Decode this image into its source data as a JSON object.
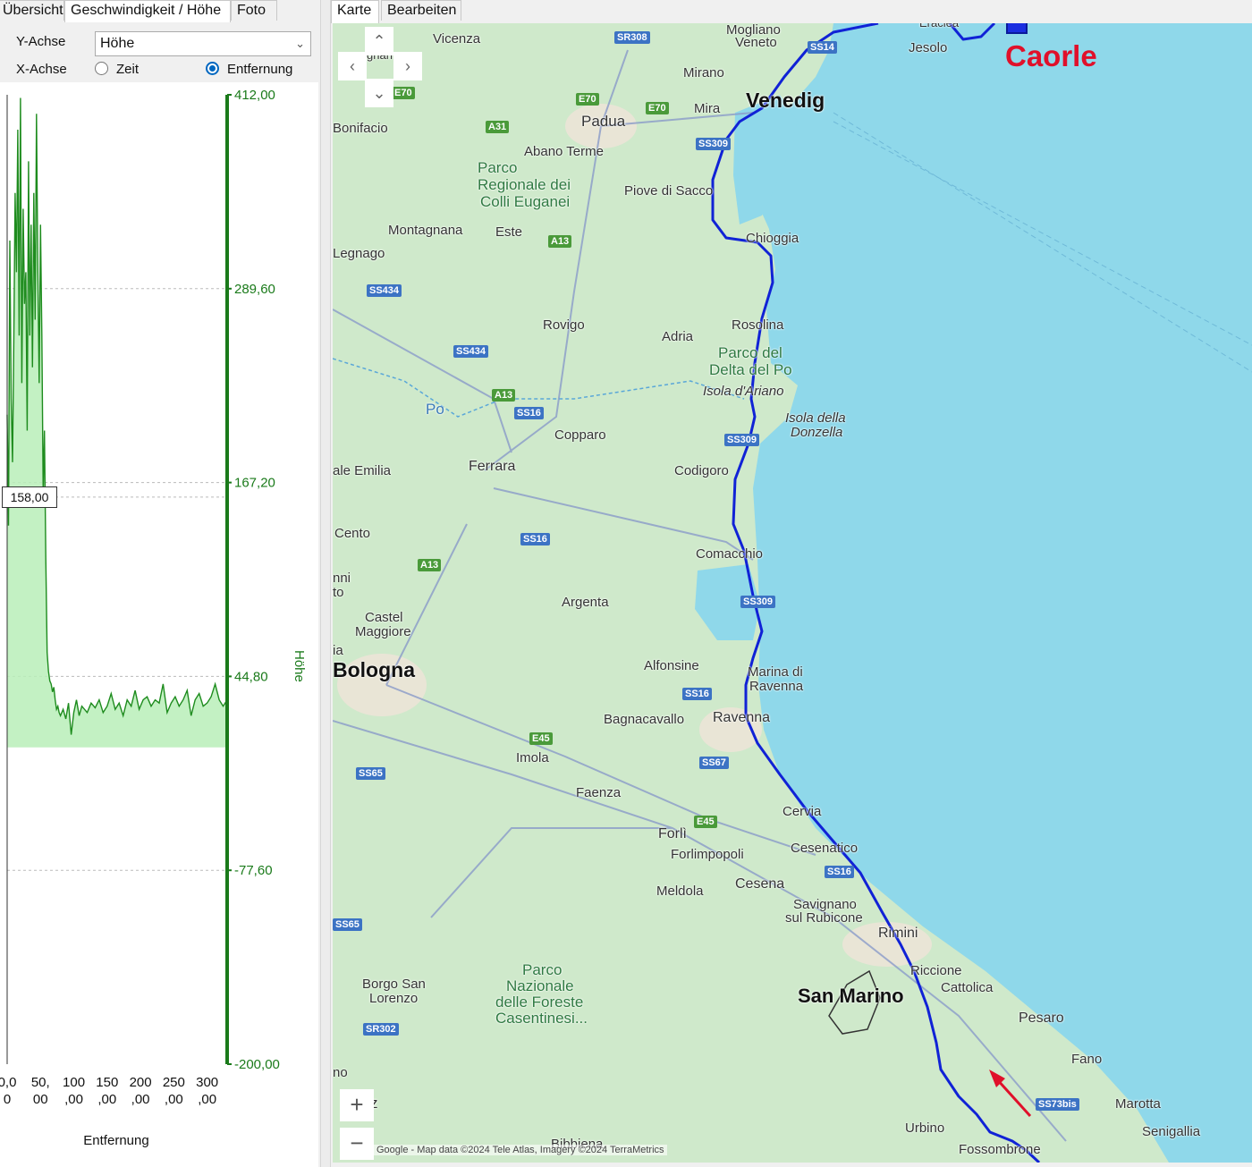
{
  "left_tabs": [
    {
      "label": "Übersicht"
    },
    {
      "label": "Geschwindigkeit / Höhe"
    },
    {
      "label": "Foto"
    }
  ],
  "options": {
    "y_axis_label": "Y-Achse",
    "y_axis_value": "Höhe",
    "x_axis_label": "X-Achse",
    "x_option_time": "Zeit",
    "x_option_distance": "Entfernung",
    "x_selected": "Entfernung"
  },
  "chart_data": {
    "type": "area",
    "ylabel": "Höhe",
    "xlabel": "Entfernung",
    "ylim": [
      -200.0,
      412.0
    ],
    "y_ticks": [
      "412,00",
      "289,60",
      "167,20",
      "44,80",
      "-77,60",
      "-200,00"
    ],
    "y_tick_values": [
      412.0,
      289.6,
      167.2,
      44.8,
      -77.6,
      -200.0
    ],
    "xlim": [
      0,
      330
    ],
    "x_ticks": [
      {
        "top": "0,0",
        "bottom": "0"
      },
      {
        "top": "50,",
        "bottom": "00"
      },
      {
        "top": "100",
        "bottom": ",00"
      },
      {
        "top": "150",
        "bottom": ",00"
      },
      {
        "top": "200",
        "bottom": ",00"
      },
      {
        "top": "250",
        "bottom": ",00"
      },
      {
        "top": "300",
        "bottom": ",00"
      }
    ],
    "x_tick_values": [
      0,
      50,
      100,
      150,
      200,
      250,
      300
    ],
    "hover_value": "158,00",
    "hover_y": 158.0,
    "series_color": "#1e8c1e",
    "fill_color": "#b9efb9",
    "axis_color": "#1a7a1a",
    "x": [
      0,
      2,
      4,
      6,
      8,
      10,
      12,
      14,
      16,
      18,
      20,
      22,
      24,
      26,
      28,
      30,
      32,
      34,
      36,
      38,
      40,
      42,
      44,
      46,
      48,
      50,
      52,
      54,
      56,
      58,
      60,
      62,
      64,
      66,
      68,
      70,
      72,
      74,
      76,
      78,
      80,
      84,
      88,
      92,
      96,
      100,
      104,
      108,
      112,
      116,
      120,
      126,
      132,
      138,
      144,
      150,
      156,
      162,
      168,
      174,
      180,
      186,
      192,
      198,
      204,
      210,
      216,
      222,
      228,
      234,
      240,
      246,
      252,
      258,
      264,
      270,
      276,
      282,
      288,
      294,
      300,
      306,
      312,
      318,
      324,
      330
    ],
    "y": [
      210,
      140,
      320,
      220,
      180,
      260,
      350,
      300,
      390,
      260,
      410,
      230,
      340,
      280,
      300,
      200,
      370,
      260,
      330,
      240,
      350,
      270,
      400,
      300,
      230,
      330,
      260,
      160,
      200,
      120,
      60,
      48,
      42,
      40,
      35,
      38,
      30,
      24,
      26,
      22,
      20,
      24,
      18,
      28,
      8,
      22,
      30,
      20,
      26,
      24,
      22,
      28,
      25,
      30,
      22,
      26,
      34,
      24,
      28,
      20,
      30,
      26,
      36,
      24,
      30,
      32,
      26,
      30,
      28,
      40,
      22,
      28,
      32,
      26,
      30,
      36,
      20,
      30,
      34,
      26,
      28,
      32,
      40,
      30,
      26,
      30
    ]
  },
  "map_tabs": [
    {
      "label": "Karte"
    },
    {
      "label": "Bearbeiten"
    }
  ],
  "map": {
    "sea_color": "#8fd8ea",
    "land_color": "#cfe9cb",
    "route_color": "#1022d6",
    "highlight_label": "Caorle",
    "attribution": "Google - Map data ©2024 Tele Atlas, Imagery ©2024 TerraMetrics",
    "places": {
      "vicenza": "Vicenza",
      "mogliano": "Mogliano",
      "veneto": "Veneto",
      "jesolo": "Jesolo",
      "mirano": "Mirano",
      "mira": "Mira",
      "venedig": "Venedig",
      "padua": "Padua",
      "bonifacio": "Bonifacio",
      "abano": "Abano Terme",
      "colli_1": "Parco",
      "colli_2": "Regionale dei",
      "colli_3": "Colli Euganei",
      "piove": "Piove di Sacco",
      "montagnana": "Montagnana",
      "este": "Este",
      "chioggia": "Chioggia",
      "legnago": "Legnago",
      "rovigo": "Rovigo",
      "rosolina": "Rosolina",
      "adria": "Adria",
      "delta_1": "Parco del",
      "delta_2": "Delta del Po",
      "isola_ariano": "Isola d'Ariano",
      "isola_donzella_1": "Isola della",
      "isola_donzella_2": "Donzella",
      "po": "Po",
      "copparo": "Copparo",
      "ferrara": "Ferrara",
      "codigoro": "Codigoro",
      "emilia": "ale Emilia",
      "cento": "Cento",
      "comacchio": "Comacchio",
      "nni": "nni",
      "to": "to",
      "argenta": "Argenta",
      "castel_1": "Castel",
      "castel_2": "Maggiore",
      "ia": "ia",
      "bologna": "Bologna",
      "alfonsine": "Alfonsine",
      "marina_1": "Marina di",
      "marina_2": "Ravenna",
      "bagnacavallo": "Bagnacavallo",
      "ravenna": "Ravenna",
      "imola": "Imola",
      "faenza": "Faenza",
      "cervia": "Cervia",
      "forli": "Forlì",
      "cesenatico": "Cesenatico",
      "forlimpopoli": "Forlimpopoli",
      "meldola": "Meldola",
      "cesena": "Cesena",
      "savignano_1": "Savignano",
      "savignano_2": "sul Rubicone",
      "rimini": "Rimini",
      "riccione": "Riccione",
      "cattolica": "Cattolica",
      "san_marino": "San Marino",
      "pesaro": "Pesaro",
      "borgo_1": "Borgo San",
      "borgo_2": "Lorenzo",
      "foreste_1": "Parco",
      "foreste_2": "Nazionale",
      "foreste_3": "delle Foreste",
      "foreste_4": "Casentinesi...",
      "fano": "Fano",
      "marotta": "Marotta",
      "no": "no",
      "z": "z",
      "urbino": "Urbino",
      "senigallia": "Senigallia",
      "bibbiena": "Bibbiena",
      "fossombrone": "Fossombrone",
      "gnan": "gnan",
      "eraclea": "Eraclea"
    },
    "shields": {
      "sr308": "SR308",
      "ss14": "SS14",
      "e70a": "E70",
      "e70b": "E70",
      "e70c": "E70",
      "a31": "A31",
      "ss309a": "SS309",
      "a13a": "A13",
      "ss434a": "SS434",
      "ss434b": "SS434",
      "a13b": "A13",
      "ss16a": "SS16",
      "ss309b": "SS309",
      "ss16b": "SS16",
      "a13c": "A13",
      "ss309c": "SS309",
      "ss16c": "SS16",
      "e45a": "E45",
      "ss67": "SS67",
      "ss65a": "SS65",
      "e45b": "E45",
      "ss16d": "SS16",
      "ss65b": "SS65",
      "sr302": "SR302",
      "ss73bis": "SS73bis"
    }
  }
}
